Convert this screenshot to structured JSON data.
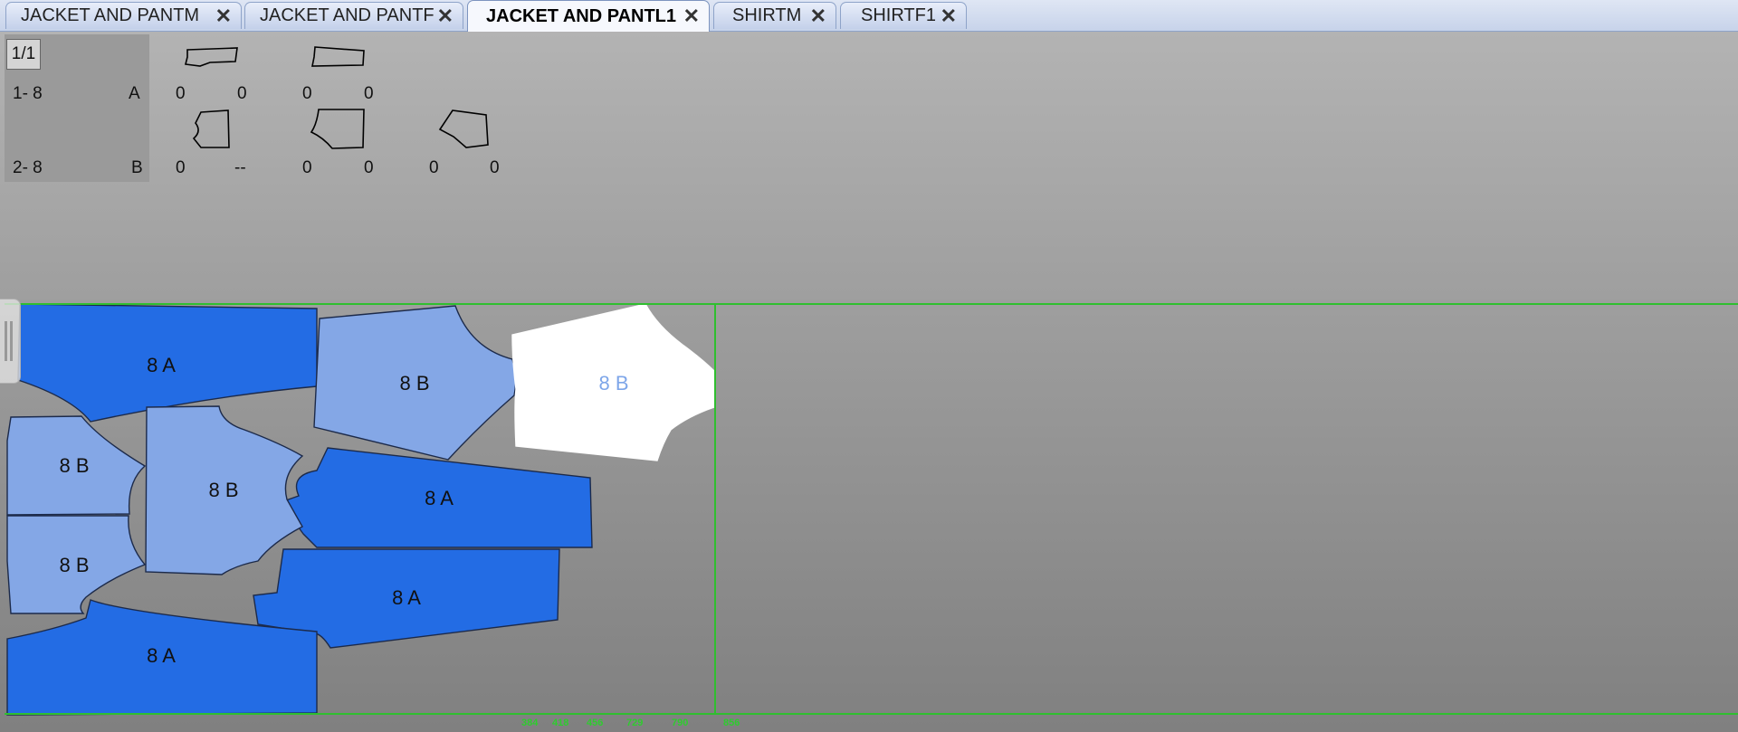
{
  "tabs": [
    {
      "label": "JACKET AND PANTM",
      "active": false
    },
    {
      "label": "JACKET AND PANTF",
      "active": false
    },
    {
      "label": "JACKET AND PANTL1",
      "active": true
    },
    {
      "label": "SHIRTM",
      "active": false
    },
    {
      "label": "SHIRTF1",
      "active": false
    }
  ],
  "close_glyph": "✕",
  "page_indicator": "1/1",
  "rows": [
    {
      "range": "1- 8",
      "code": "A",
      "counts": [
        "0",
        "0",
        "0",
        "0"
      ]
    },
    {
      "range": "2- 8",
      "code": "B",
      "counts": [
        "0",
        "--",
        "0",
        "0",
        "0",
        "0"
      ]
    }
  ],
  "pieces": [
    {
      "label": "8 A",
      "fill": "#236ce4"
    },
    {
      "label": "8 B",
      "fill": "#84a7e6"
    },
    {
      "label": "8 B",
      "fill": "#ffffff",
      "label_color": "#7ea6e9",
      "selected": true
    },
    {
      "label": "8 B",
      "fill": "#84a7e6"
    },
    {
      "label": "8 B",
      "fill": "#84a7e6"
    },
    {
      "label": "8 A",
      "fill": "#236ce4"
    },
    {
      "label": "8 B",
      "fill": "#84a7e6"
    },
    {
      "label": "8 A",
      "fill": "#236ce4"
    },
    {
      "label": "8 A",
      "fill": "#236ce4"
    }
  ],
  "ruler_marks": [
    "384",
    "418",
    "456",
    "729",
    "790",
    "856"
  ],
  "colors": {
    "marker_line": "#2fbf2f",
    "piece_a": "#236ce4",
    "piece_b": "#84a7e6"
  },
  "icons": {
    "tab_close": "close-icon",
    "side_handle": "panel-handle-icon"
  }
}
